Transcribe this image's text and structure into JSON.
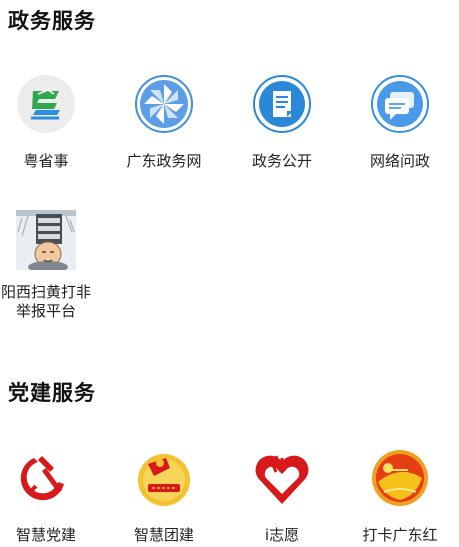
{
  "sections": [
    {
      "title": "政务服务",
      "items": [
        {
          "label": "粤省事",
          "icon": "yue-sheng-shi-logo-icon"
        },
        {
          "label": "广东政务网",
          "icon": "pinwheel-icon"
        },
        {
          "label": "政务公开",
          "icon": "document-icon"
        },
        {
          "label": "网络问政",
          "icon": "chat-bubbles-icon"
        },
        {
          "label": "阳西扫黄打非举报平台",
          "icon": "report-platform-image"
        }
      ]
    },
    {
      "title": "党建服务",
      "items": [
        {
          "label": "智慧党建",
          "icon": "hammer-sickle-icon"
        },
        {
          "label": "智慧团建",
          "icon": "youth-league-badge-icon"
        },
        {
          "label": "i志愿",
          "icon": "heart-hand-icon"
        },
        {
          "label": "打卡广东红",
          "icon": "guangdong-red-badge-icon"
        }
      ]
    }
  ],
  "colors": {
    "accent_blue": "#3a8ee6",
    "party_red": "#d7191b",
    "gold": "#f2c230",
    "green": "#4cb648"
  }
}
